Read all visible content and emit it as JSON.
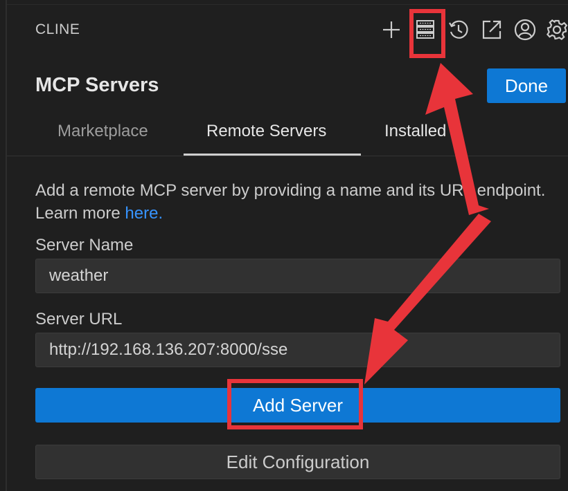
{
  "app": {
    "title": "CLINE"
  },
  "toolbar": {
    "icons": [
      "plus-icon",
      "server-icon",
      "history-icon",
      "popout-icon",
      "account-icon",
      "gear-icon"
    ]
  },
  "header": {
    "title": "MCP Servers",
    "done_label": "Done"
  },
  "tabs": [
    {
      "label": "Marketplace",
      "active": false
    },
    {
      "label": "Remote Servers",
      "active": true
    },
    {
      "label": "Installed",
      "active": false
    }
  ],
  "remote": {
    "description": "Add a remote MCP server by providing a name and its URL endpoint. Learn more",
    "learn_more_link": "here.",
    "name_label": "Server Name",
    "name_value": "weather",
    "url_label": "Server URL",
    "url_value": "http://192.168.136.207:8000/sse",
    "add_label": "Add Server",
    "edit_label": "Edit Configuration"
  },
  "colors": {
    "accent": "#0e78d4",
    "link": "#3794ff",
    "annotation": "#e8343a",
    "background": "#1f1f1f"
  }
}
